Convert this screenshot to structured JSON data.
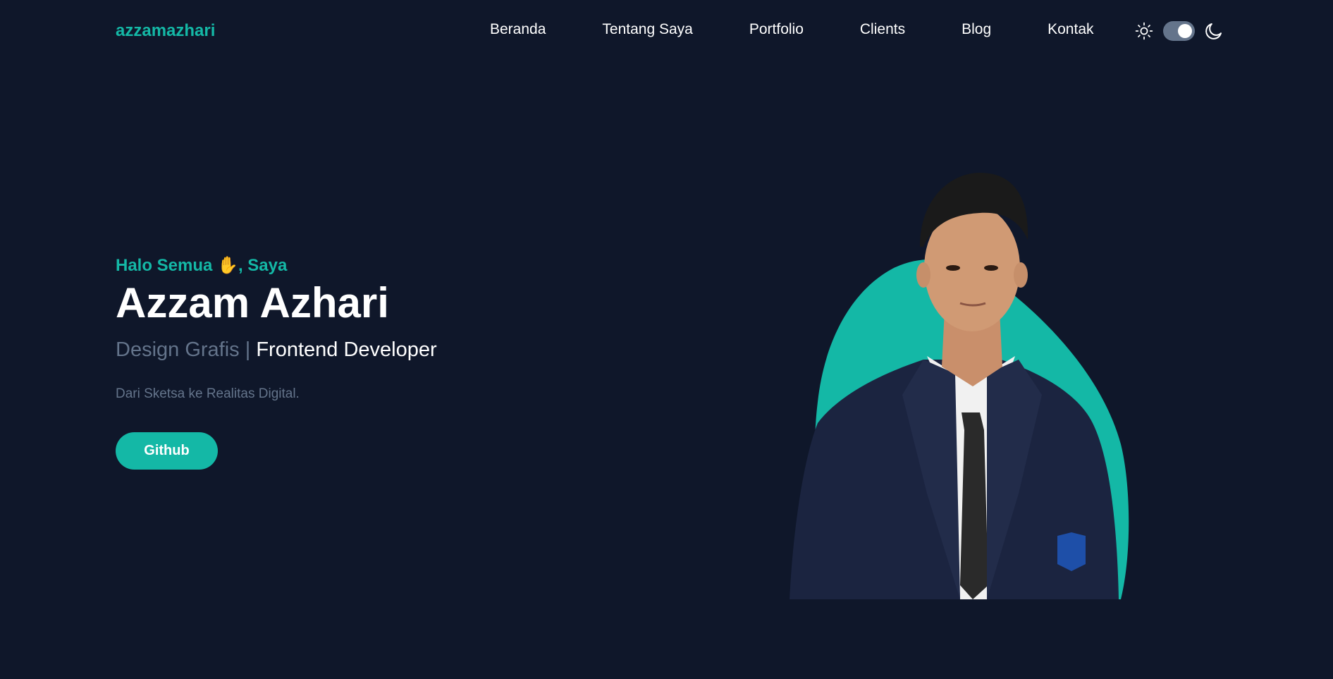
{
  "brand": {
    "logo_text": "azzamazhari"
  },
  "nav": {
    "items": [
      {
        "label": "Beranda"
      },
      {
        "label": "Tentang Saya"
      },
      {
        "label": "Portfolio"
      },
      {
        "label": "Clients"
      },
      {
        "label": "Blog"
      },
      {
        "label": "Kontak"
      }
    ]
  },
  "theme": {
    "light_icon": "sun-icon",
    "dark_icon": "moon-icon",
    "toggle_state": "dark"
  },
  "hero": {
    "greeting_prefix": "Halo Semua",
    "greeting_emoji": "✋",
    "greeting_suffix": ", Saya",
    "name": "Azzam Azhari",
    "role_secondary": "Design Grafis",
    "role_separator": "|",
    "role_primary": "Frontend Developer",
    "tagline": "Dari Sketsa ke Realitas Digital.",
    "cta_label": "Github"
  },
  "colors": {
    "background": "#0f172a",
    "accent": "#14b8a6",
    "muted": "#64748b",
    "text": "#ffffff"
  }
}
